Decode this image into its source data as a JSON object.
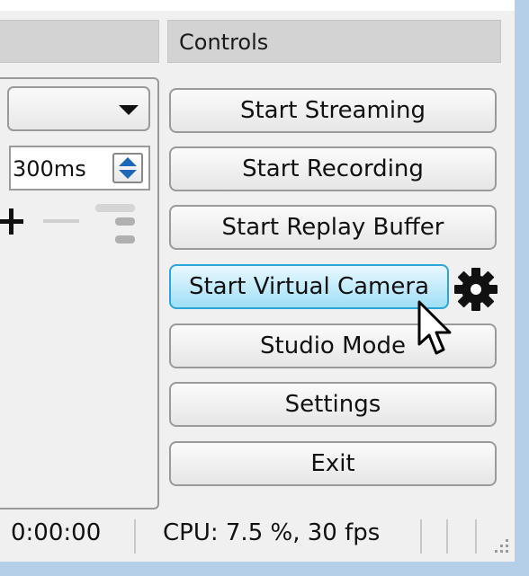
{
  "controls_dock": {
    "title": "Controls",
    "buttons": {
      "start_streaming": "Start Streaming",
      "start_recording": "Start Recording",
      "start_replay_buffer": "Start Replay Buffer",
      "start_virtual_camera": "Start Virtual Camera",
      "studio_mode": "Studio Mode",
      "settings": "Settings",
      "exit": "Exit"
    },
    "virtual_camera_settings_icon": "gear-icon"
  },
  "left_dock": {
    "title": "",
    "transition_duration": "300ms",
    "combo_icon": "chevron-down-icon"
  },
  "status_bar": {
    "time": "0:00:00",
    "cpu": "CPU: 7.5 %, 30 fps"
  },
  "colors": {
    "active_button_top": "#e9f8ff",
    "active_button_bottom": "#9fdff6",
    "active_button_border": "#2aa6d8",
    "spin_arrow": "#1e68b8",
    "window_edge": "#b6cfe9"
  }
}
